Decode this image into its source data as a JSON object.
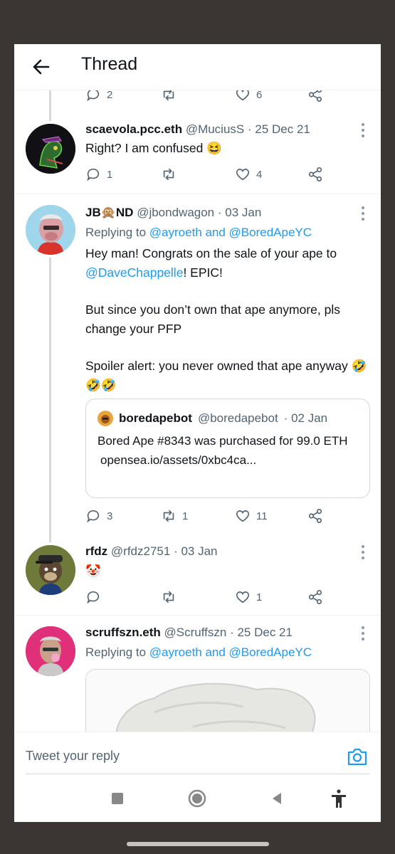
{
  "header": {
    "title": "Thread"
  },
  "tweets": [
    {
      "name": "scaevola.pcc.eth",
      "handle": "@MuciusS",
      "date": "· 25 Dec 21",
      "text": "Right? I am confused 😆",
      "replies": "1",
      "retweets": "",
      "likes": "4"
    },
    {
      "name": "JB🙊ND",
      "handle": "@jbondwagon",
      "date": "· 03 Jan",
      "replying_prefix": "Replying to ",
      "replying_to": "@ayroeth and @BoredApeYC",
      "text_p1a": "Hey man! Congrats on the sale of your ape to ",
      "text_p1_link": "@DaveChappelle",
      "text_p1b": "! EPIC!",
      "text_p2": "But since you don’t own that ape anymore, pls change your PFP",
      "text_p3": "Spoiler alert: you never owned that ape anyway 🤣🤣🤣",
      "quote": {
        "name": "boredapebot",
        "handle": "@boredapebot",
        "date": "· 02 Jan",
        "text": "Bored Ape #8343 was purchased for 99.0 ETH",
        "link": "opensea.io/assets/0xbc4ca..."
      },
      "replies": "3",
      "retweets": "1",
      "likes": "11"
    },
    {
      "name": "rfdz",
      "handle": "@rfdz2751",
      "date": "· 03 Jan",
      "text": "🤡",
      "replies": "",
      "retweets": "",
      "likes": "1"
    },
    {
      "name": "scruffszn.eth",
      "handle": "@Scruffszn",
      "date": "· 25 Dec 21",
      "replying_prefix": "Replying to ",
      "replying_to": "@ayroeth and @BoredApeYC"
    }
  ],
  "previous_tweet_counts": {
    "replies": "2",
    "likes": "6"
  },
  "reply_bar": {
    "placeholder": "Tweet your reply"
  },
  "colors": {
    "link": "#1d9bf0",
    "muted": "#536471",
    "text": "#0f1419"
  },
  "nav": [
    "stop-icon",
    "home-circle-icon",
    "back-triangle-icon",
    "accessibility-icon"
  ]
}
